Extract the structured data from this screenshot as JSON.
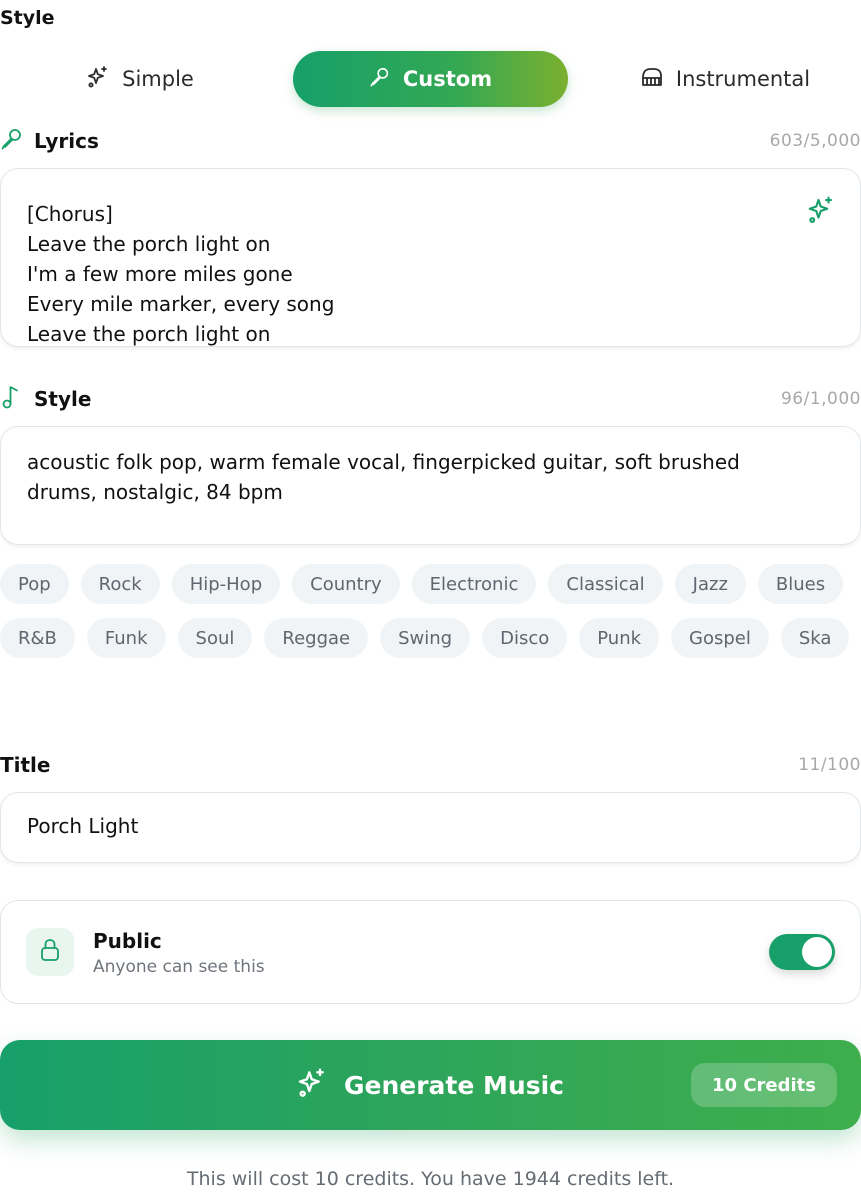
{
  "style_section": {
    "title": "Style",
    "tabs": [
      {
        "label": "Simple",
        "icon": "sparkles-icon",
        "active": false
      },
      {
        "label": "Custom",
        "icon": "microphone-icon",
        "active": true
      },
      {
        "label": "Instrumental",
        "icon": "piano-icon",
        "active": false
      }
    ]
  },
  "lyrics": {
    "label": "Lyrics",
    "icon": "microphone-icon",
    "count": "603/5,000",
    "text": "[Chorus]\nLeave the porch light on\nI'm a few more miles gone\nEvery mile marker, every song\nLeave the porch light on",
    "assist_icon": "sparkles-icon"
  },
  "style_field": {
    "label": "Style",
    "icon": "music-note-icon",
    "count": "96/1,000",
    "text": "acoustic folk pop, warm female vocal, fingerpicked guitar, soft brushed drums, nostalgic, 84 bpm"
  },
  "genres": [
    "Pop",
    "Rock",
    "Hip-Hop",
    "Country",
    "Electronic",
    "Classical",
    "Jazz",
    "Blues",
    "R&B",
    "Funk",
    "Soul",
    "Reggae",
    "Swing",
    "Disco",
    "Punk",
    "Gospel",
    "Ska"
  ],
  "title_field": {
    "label": "Title",
    "count": "11/100",
    "value": "Porch Light"
  },
  "visibility": {
    "title": "Public",
    "subtitle": "Anyone can see this",
    "icon": "lock-icon",
    "enabled": true
  },
  "generate": {
    "label": "Generate Music",
    "icon": "sparkles-icon",
    "credits_badge": "10 Credits"
  },
  "footer_note": "This will cost 10 credits. You have 1944 credits left.",
  "colors": {
    "accent": "#17a06a",
    "accent_end": "#7bb02f",
    "chip_bg": "#f1f4f6"
  }
}
